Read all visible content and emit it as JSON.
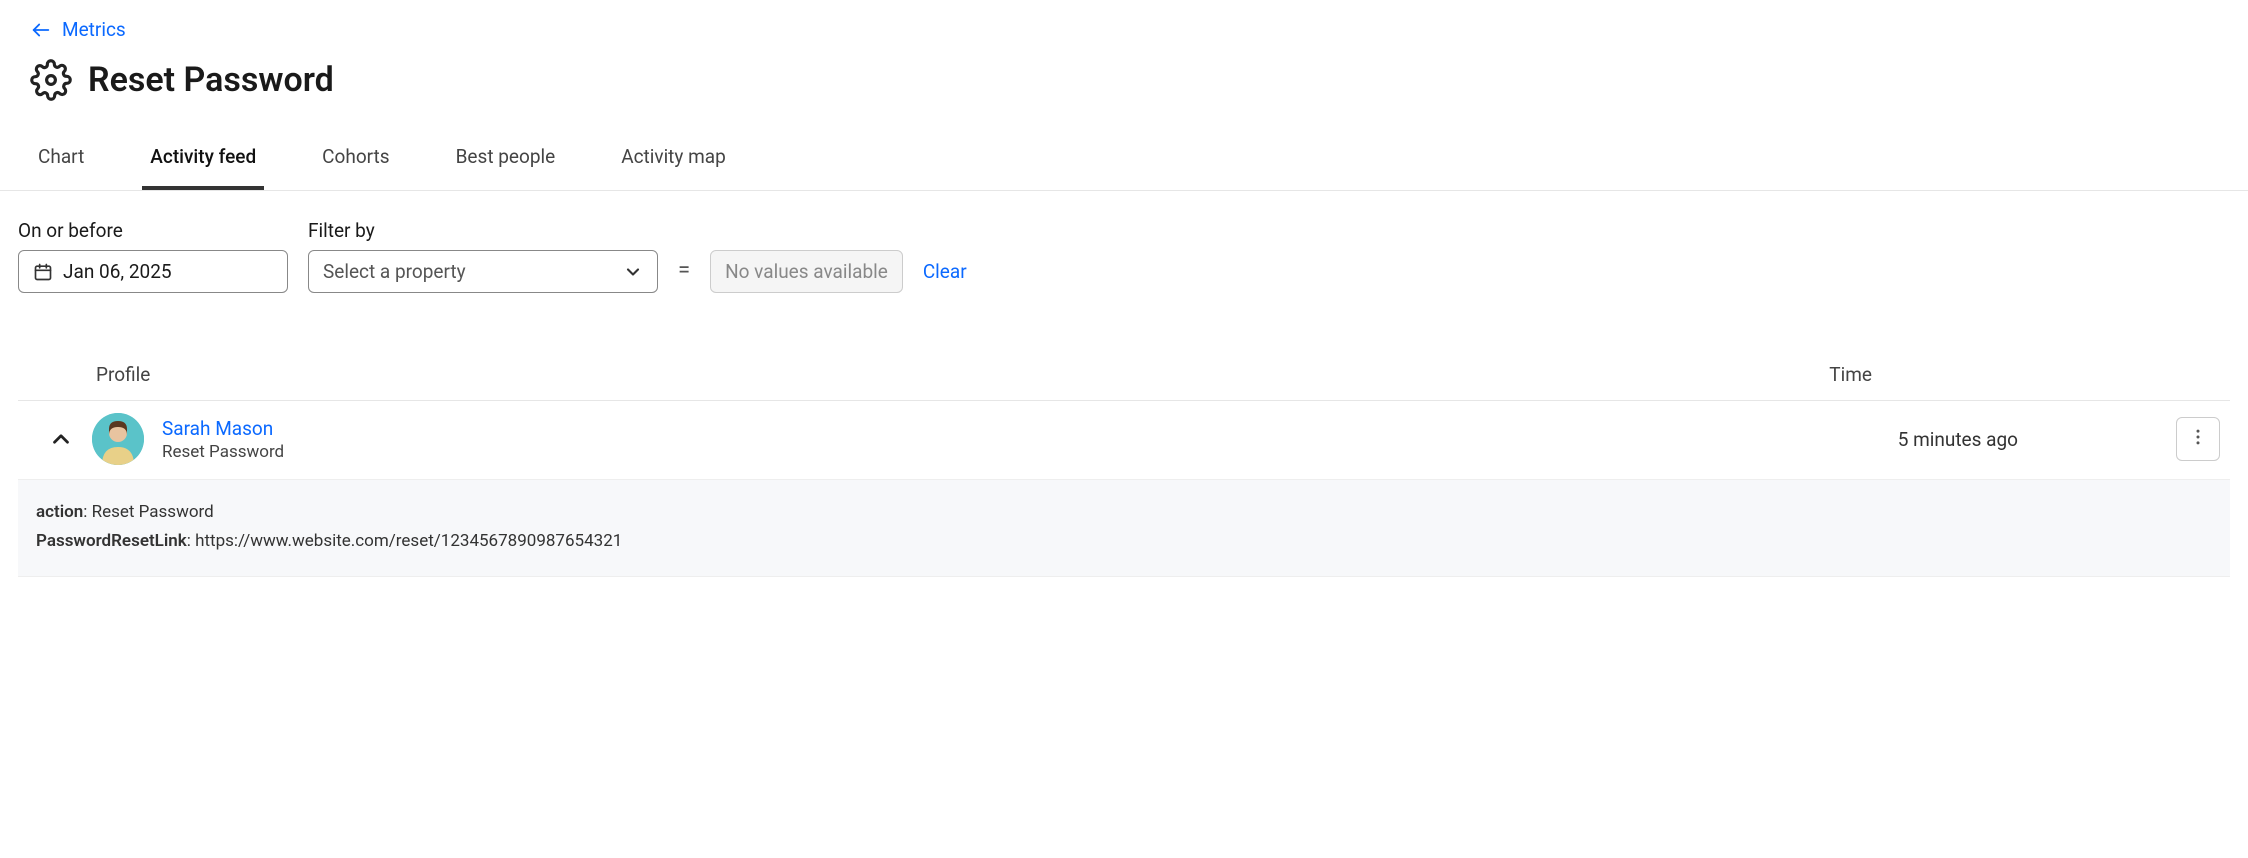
{
  "breadcrumb": {
    "label": "Metrics"
  },
  "page": {
    "title": "Reset Password"
  },
  "tabs": [
    {
      "label": "Chart"
    },
    {
      "label": "Activity feed"
    },
    {
      "label": "Cohorts"
    },
    {
      "label": "Best people"
    },
    {
      "label": "Activity map"
    }
  ],
  "filters": {
    "date_label": "On or before",
    "date_value": "Jan 06, 2025",
    "filter_by_label": "Filter by",
    "select_placeholder": "Select a property",
    "equals_sign": "=",
    "no_values": "No values available",
    "clear_label": "Clear"
  },
  "feed": {
    "headers": {
      "profile": "Profile",
      "time": "Time"
    },
    "rows": [
      {
        "name": "Sarah Mason",
        "event": "Reset Password",
        "time": "5 minutes ago",
        "details": {
          "action_key": "action",
          "action_value": "Reset Password",
          "link_key": "PasswordResetLink",
          "link_value": "https://www.website.com/reset/1234567890987654321"
        }
      }
    ]
  }
}
